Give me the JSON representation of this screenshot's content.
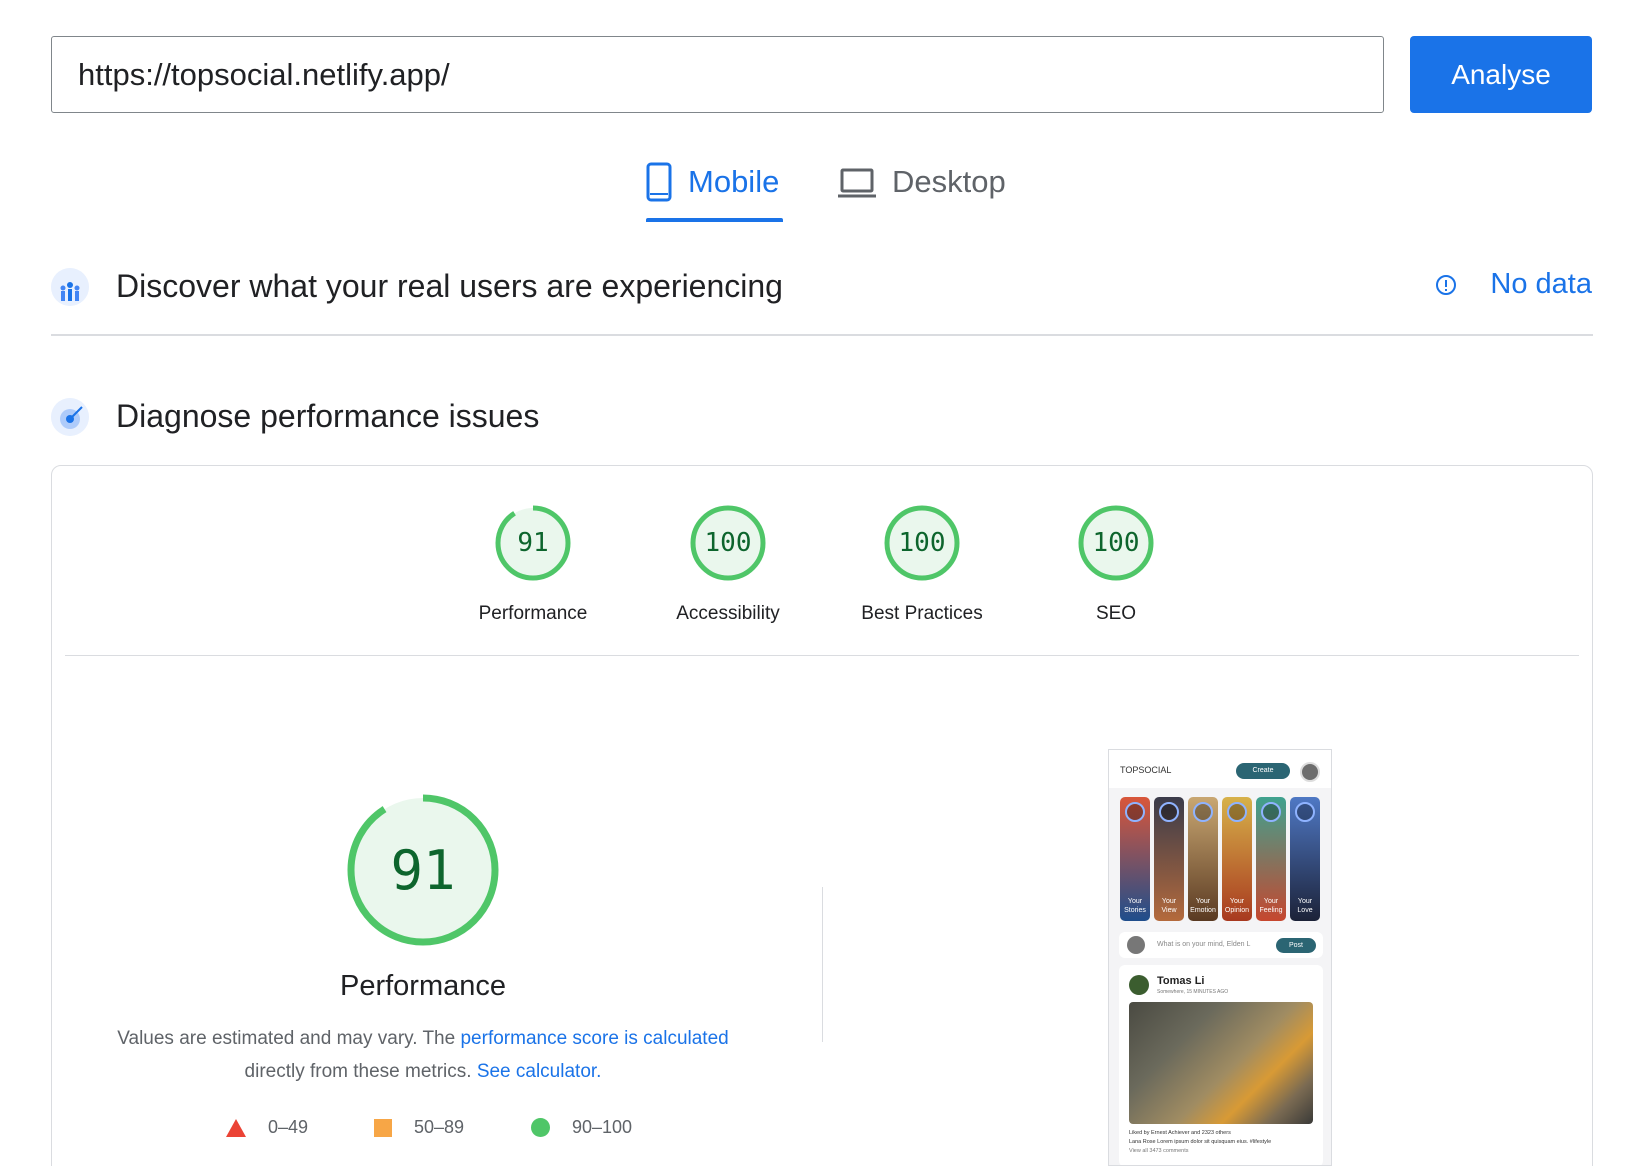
{
  "url_bar": {
    "value": "https://topsocial.netlify.app/",
    "button_label": "Analyse"
  },
  "tabs": [
    {
      "label": "Mobile",
      "icon": "smartphone-icon",
      "selected": true
    },
    {
      "label": "Desktop",
      "icon": "laptop-icon",
      "selected": false
    }
  ],
  "field_data": {
    "title": "Discover what your real users are experiencing",
    "status_label": "No data",
    "icon": "crux-people-icon"
  },
  "lab_data": {
    "title": "Diagnose performance issues",
    "icon": "lighthouse-target-icon",
    "scores": [
      {
        "value": "91",
        "label": "Performance",
        "score": 91
      },
      {
        "value": "100",
        "label": "Accessibility",
        "score": 100
      },
      {
        "value": "100",
        "label": "Best Practices",
        "score": 100
      },
      {
        "value": "100",
        "label": "SEO",
        "score": 100
      }
    ],
    "main": {
      "value": "91",
      "score": 91,
      "label": "Performance",
      "desc_1": "Values are estimated and may vary. The",
      "desc_link_1": "performance score is calculated",
      "desc_2": "directly from these metrics.",
      "desc_link_2": "See calculator."
    },
    "legend": [
      {
        "range": "0–49",
        "shape": "triangle",
        "color": "#eb4335"
      },
      {
        "range": "50–89",
        "shape": "square",
        "color": "#f7a646"
      },
      {
        "range": "90–100",
        "shape": "circle",
        "color": "#4fc668"
      }
    ]
  },
  "screenshot": {
    "logo": "TOPSOCIAL",
    "create_label": "Create",
    "stories": [
      {
        "label": "Your Stories",
        "colors": [
          "#d9563a",
          "#1f4e8c"
        ]
      },
      {
        "label": "Your View",
        "colors": [
          "#3a3b4a",
          "#b46a3c"
        ]
      },
      {
        "label": "Your Emotion",
        "colors": [
          "#c9a772",
          "#5a3a22"
        ]
      },
      {
        "label": "Your Opinion",
        "colors": [
          "#d7b24a",
          "#a8391f"
        ]
      },
      {
        "label": "Your Feeling",
        "colors": [
          "#3fa28f",
          "#c6472f"
        ]
      },
      {
        "label": "Your Love",
        "colors": [
          "#4f78c4",
          "#1c2238"
        ]
      }
    ],
    "composer_placeholder": "What is on your mind, Elden L",
    "post_label": "Post",
    "author": "Tomas Li",
    "meta": "Somewhere, 15 MINUTES AGO",
    "likes": "Liked by Ernest Achiever and 2323 others",
    "caption": "Lana Rose Lorem ipsum dolor sit quisquam eius. #lifestyle",
    "comments": "View all 3473 comments"
  },
  "colors": {
    "accent": "#1a73e8",
    "pass_green": "#4fc668",
    "pass_fill": "#eaf7ed",
    "pass_text": "#0d652d"
  }
}
